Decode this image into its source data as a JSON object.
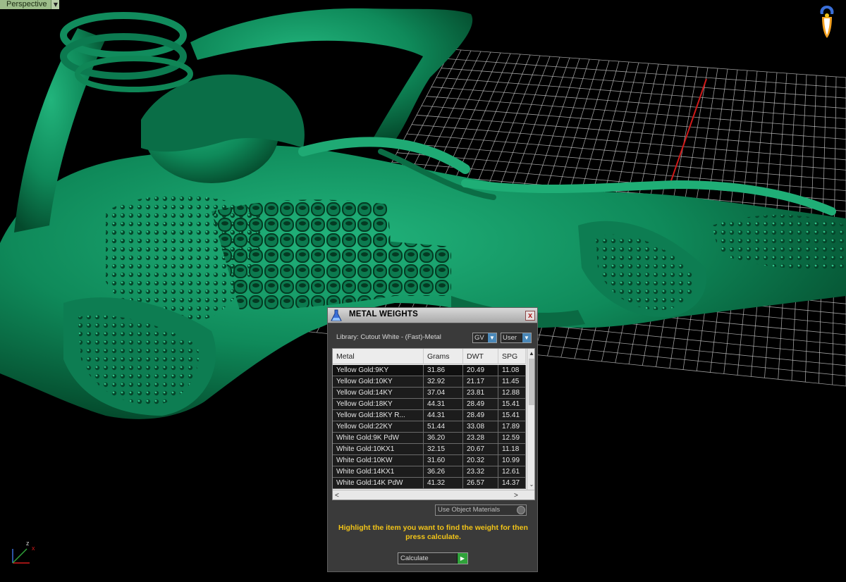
{
  "viewport": {
    "view_name": "Perspective",
    "axis": {
      "x_label": "x",
      "z_label": "z"
    },
    "colors": {
      "model": "#0e8a5c",
      "grid": "#cfcfcf",
      "axis_line": "#d11a1a",
      "background": "#000000"
    }
  },
  "dialog": {
    "title": "METAL WEIGHTS",
    "close_label": "x",
    "library_label": "Library: Cutout White - (Fast)-Metal",
    "gv_combo": "GV",
    "user_combo": "User",
    "table": {
      "columns": [
        "Metal",
        "Grams",
        "DWT",
        "SPG"
      ],
      "rows": [
        [
          "Yellow Gold:9KY",
          "31.86",
          "20.49",
          "11.08"
        ],
        [
          "Yellow Gold:10KY",
          "32.92",
          "21.17",
          "11.45"
        ],
        [
          "Yellow Gold:14KY",
          "37.04",
          "23.81",
          "12.88"
        ],
        [
          "Yellow Gold:18KY",
          "44.31",
          "28.49",
          "15.41"
        ],
        [
          "Yellow Gold:18KY R...",
          "44.31",
          "28.49",
          "15.41"
        ],
        [
          "Yellow Gold:22KY",
          "51.44",
          "33.08",
          "17.89"
        ],
        [
          "White Gold:9K PdW",
          "36.20",
          "23.28",
          "12.59"
        ],
        [
          "White Gold:10KX1",
          "32.15",
          "20.67",
          "11.18"
        ],
        [
          "White Gold:10KW",
          "31.60",
          "20.32",
          "10.99"
        ],
        [
          "White Gold:14KX1",
          "36.26",
          "23.32",
          "12.61"
        ],
        [
          "White Gold:14K PdW",
          "41.32",
          "26.57",
          "14.37"
        ]
      ]
    },
    "use_object_materials": "Use Object Materials",
    "hint": "Highlight the item you want to find the weight for then press calculate.",
    "calculate_label": "Calculate"
  }
}
